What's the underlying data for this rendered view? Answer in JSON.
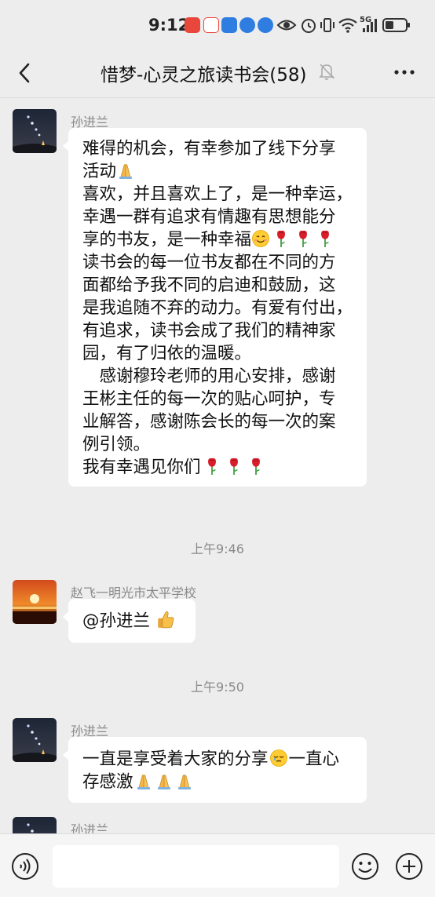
{
  "status_bar": {
    "time": "9:12",
    "network": "5G"
  },
  "header": {
    "title": "惜梦-心灵之旅读书会(58)"
  },
  "messages": [
    {
      "sender": "孙进兰",
      "lines": [
        "难得的机会，有幸参加了线下分享",
        "活动",
        "喜欢，并且喜欢上了，是一种幸运，",
        "幸遇一群有追求有情趣有思想能分",
        "享的书友，是一种幸福",
        "读书会的每一位书友都在不同的方",
        "面都给予我不同的启迪和鼓励，这",
        "是我追随不弃的动力。有爱有付出，",
        "有追求，读书会成了我们的精神家",
        "园，有了归依的温暖。",
        "　感谢穆玲老师的用心安排，感谢",
        "王彬主任的每一次的贴心呵护，专",
        "业解答，感谢陈会长的每一次的案",
        "例引领。",
        "我有幸遇见你们"
      ]
    },
    {
      "timestamp": "上午9:46"
    },
    {
      "sender": "赵飞一明光市太平学校",
      "lines": [
        "@孙进兰 "
      ]
    },
    {
      "timestamp": "上午9:50"
    },
    {
      "sender": "孙进兰",
      "lines": [
        "一直是享受着大家的分享",
        "一直心",
        "存感激"
      ]
    },
    {
      "sender": "孙进兰"
    }
  ],
  "input_bar": {
    "placeholder": ""
  },
  "colors": {
    "background": "#ededed",
    "bubble": "#ffffff",
    "meta_text": "#8a8a8a"
  }
}
